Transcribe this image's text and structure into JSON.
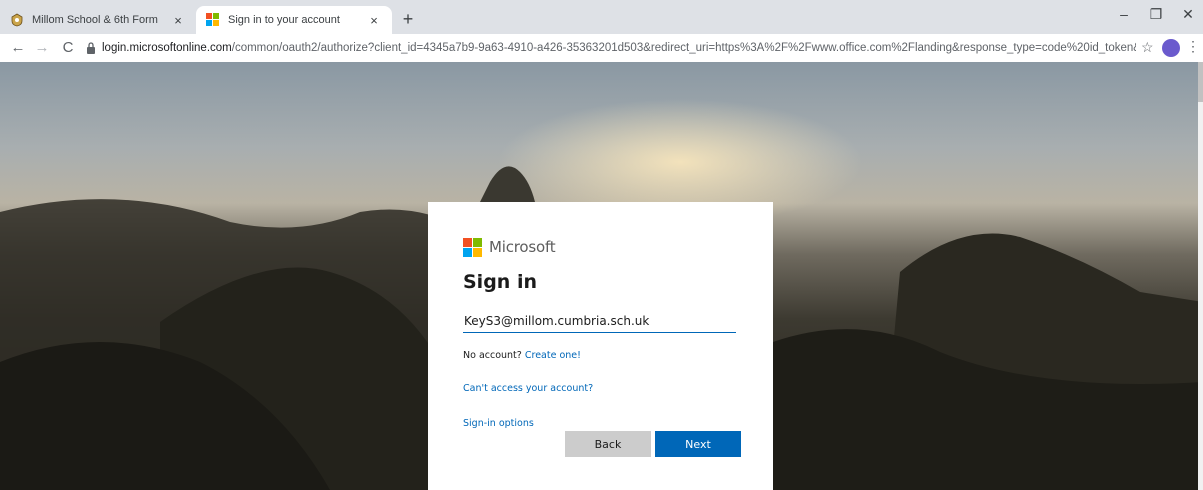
{
  "browser": {
    "tabs": [
      {
        "title": "Millom School & 6th Form",
        "active": false,
        "favicon": "school-crest-icon"
      },
      {
        "title": "Sign in to your account",
        "active": true,
        "favicon": "microsoft-logo-icon"
      }
    ],
    "new_tab_symbol": "+",
    "close_symbol": "×",
    "window_controls": {
      "minimize": "–",
      "restore": "❐",
      "close": "✕"
    },
    "nav": {
      "back": "←",
      "forward": "→",
      "reload": "C"
    },
    "address": {
      "domain": "login.microsoftonline.com",
      "path": "/common/oauth2/authorize?client_id=4345a7b9-9a63-4910-a426-35363201d503&redirect_uri=https%3A%2F%2Fwww.office.com%2Flanding&response_type=code%20id_token&..."
    },
    "star_symbol": "☆",
    "menu_symbol": "⋮"
  },
  "signin": {
    "brand": "Microsoft",
    "title": "Sign in",
    "email_value": "KeyS3@millom.cumbria.sch.uk",
    "no_account_text": "No account? ",
    "create_link": "Create one!",
    "cant_access_link": "Can't access your account?",
    "signin_options_link": "Sign-in options",
    "back_label": "Back",
    "next_label": "Next"
  },
  "colors": {
    "accent": "#0067b8",
    "ms_red": "#f25022",
    "ms_green": "#7fba00",
    "ms_blue": "#00a4ef",
    "ms_yellow": "#ffb900"
  }
}
